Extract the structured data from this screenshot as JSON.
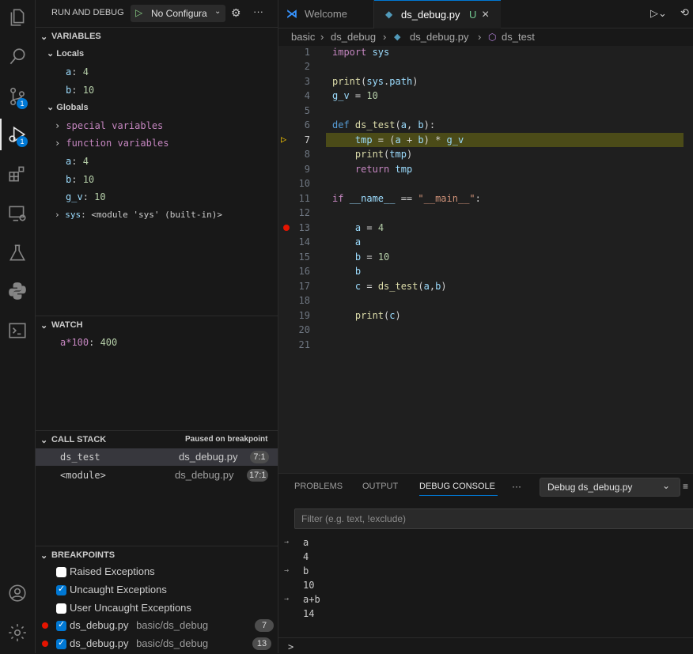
{
  "activity": {
    "scm_badge": "1",
    "debug_badge": "1"
  },
  "sidebar": {
    "title": "RUN AND DEBUG",
    "config": "No Configura",
    "more": "···",
    "variables": {
      "header": "VARIABLES",
      "locals_label": "Locals",
      "locals": [
        {
          "name": "a",
          "value": "4"
        },
        {
          "name": "b",
          "value": "10"
        }
      ],
      "globals_label": "Globals",
      "special": "special variables",
      "function": "function variables",
      "globals": [
        {
          "name": "a",
          "value": "4"
        },
        {
          "name": "b",
          "value": "10"
        },
        {
          "name": "g_v",
          "value": "10"
        }
      ],
      "sys_name": "sys",
      "sys_value": "<module 'sys' (built-in)>"
    },
    "watch": {
      "header": "WATCH",
      "expr": "a*100",
      "value": "400"
    },
    "callstack": {
      "header": "CALL STACK",
      "status": "Paused on breakpoint",
      "frames": [
        {
          "name": "ds_test",
          "file": "ds_debug.py",
          "pos": "7:1"
        },
        {
          "name": "<module>",
          "file": "ds_debug.py",
          "pos": "17:1"
        }
      ]
    },
    "breakpoints": {
      "header": "BREAKPOINTS",
      "items": [
        {
          "label": "Raised Exceptions"
        },
        {
          "label": "Uncaught Exceptions"
        },
        {
          "label": "User Uncaught Exceptions"
        }
      ],
      "files": [
        {
          "file": "ds_debug.py",
          "path": "basic/ds_debug",
          "line": "7"
        },
        {
          "file": "ds_debug.py",
          "path": "basic/ds_debug",
          "line": "13"
        }
      ]
    }
  },
  "tabs": {
    "welcome": "Welcome",
    "active": "ds_debug.py",
    "active_status": "U",
    "close": "×"
  },
  "breadcrumb": {
    "folder1": "basic",
    "folder2": "ds_debug",
    "file": "ds_debug.py",
    "symbol": "ds_test",
    "sep": "›"
  },
  "editor": {
    "line_numbers": [
      "1",
      "2",
      "3",
      "4",
      "5",
      "6",
      "7",
      "8",
      "9",
      "10",
      "11",
      "12",
      "13",
      "14",
      "15",
      "16",
      "17",
      "18",
      "19",
      "20",
      "21"
    ],
    "code": {
      "l1a": "import",
      "l1b": " sys",
      "l3a": "print",
      "l3b": "(",
      "l3c": "sys",
      "l3d": ".",
      "l3e": "path",
      "l3f": ")",
      "l4a": "g_v",
      "l4b": " = ",
      "l4c": "10",
      "l6a": "def ",
      "l6b": "ds_test",
      "l6c": "(",
      "l6d": "a",
      "l6e": ", ",
      "l6f": "b",
      "l6g": "):",
      "l7a": "    tmp",
      "l7b": " = (",
      "l7c": "a",
      "l7d": " + ",
      "l7e": "b",
      "l7f": ") * ",
      "l7g": "g_v",
      "l8a": "    ",
      "l8b": "print",
      "l8c": "(",
      "l8d": "tmp",
      "l8e": ")",
      "l9a": "    ",
      "l9b": "return",
      "l9c": " tmp",
      "l11a": "if ",
      "l11b": "__name__",
      "l11c": " == ",
      "l11d": "\"__main__\"",
      "l11e": ":",
      "l13a": "    a",
      "l13b": " = ",
      "l13c": "4",
      "l14a": "    a",
      "l15a": "    b",
      "l15b": " = ",
      "l15c": "10",
      "l16a": "    b",
      "l17a": "    c",
      "l17b": " = ",
      "l17c": "ds_test",
      "l17d": "(",
      "l17e": "a",
      "l17f": ",",
      "l17g": "b",
      "l17h": ")",
      "l19a": "    ",
      "l19b": "print",
      "l19c": "(",
      "l19d": "c",
      "l19e": ")"
    }
  },
  "panel": {
    "tabs": [
      "PROBLEMS",
      "OUTPUT",
      "DEBUG CONSOLE"
    ],
    "more": "···",
    "dropdown": "Debug ds_debug.py",
    "filter_placeholder": "Filter (e.g. text, !exclude)",
    "console": [
      {
        "kind": "in",
        "text": "a"
      },
      {
        "kind": "out",
        "text": "4"
      },
      {
        "kind": "in",
        "text": "b"
      },
      {
        "kind": "out",
        "text": "10"
      },
      {
        "kind": "in",
        "text": "a+b"
      },
      {
        "kind": "out",
        "text": "14"
      }
    ],
    "prompt": ">"
  },
  "colors": {
    "accent": "#0078d4",
    "highlight_line": "#4b4b18",
    "breakpoint": "#e51400",
    "current_pointer": "#ffcc00"
  }
}
